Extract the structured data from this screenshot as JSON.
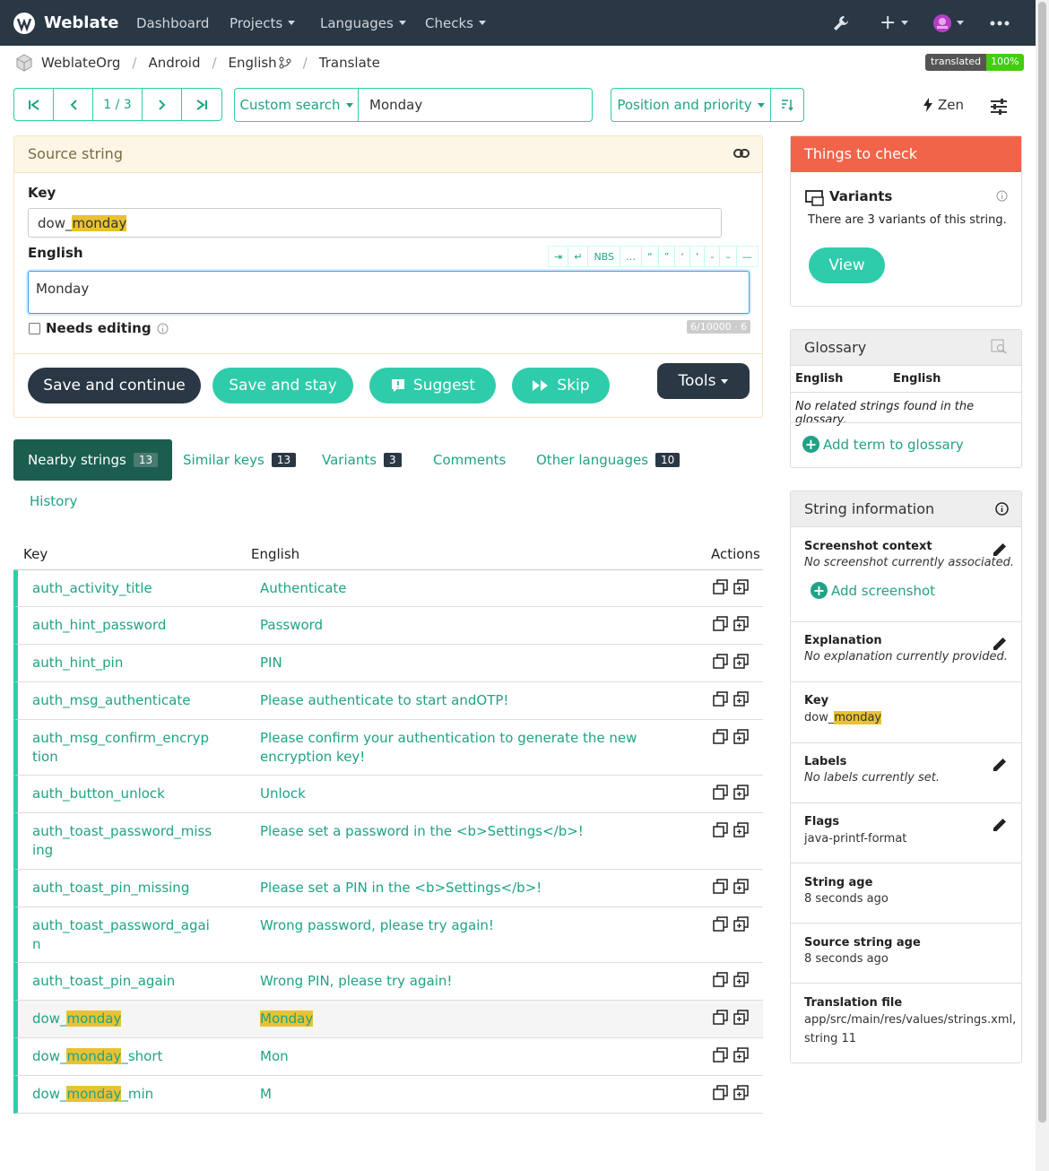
{
  "nav": {
    "brand": "Weblate",
    "items": [
      "Dashboard",
      "Projects",
      "Languages",
      "Checks"
    ]
  },
  "breadcrumb": [
    "WeblateOrg",
    "Android",
    "English",
    "Translate"
  ],
  "badge": {
    "label": "translated",
    "value": "100%"
  },
  "toolbar": {
    "position": "1 / 3",
    "search_button": "Custom search",
    "search_value": "Monday",
    "sort_button": "Position and priority",
    "zen": "Zen"
  },
  "source": {
    "title": "Source string",
    "key_label": "Key",
    "key_prefix": "dow_",
    "key_highlight": "monday",
    "lang_label": "English",
    "special_chars": [
      "⇥",
      "↵",
      "NBS",
      "…",
      "“",
      "”",
      "‘",
      "’",
      "-",
      "–",
      "—"
    ],
    "text": "Monday",
    "needs_editing": "Needs editing",
    "counter": "6/10000 · 6",
    "buttons": {
      "save_continue": "Save and continue",
      "save_stay": "Save and stay",
      "suggest": "Suggest",
      "skip": "Skip",
      "tools": "Tools"
    }
  },
  "tabs": [
    {
      "label": "Nearby strings",
      "count": "13"
    },
    {
      "label": "Similar keys",
      "count": "13"
    },
    {
      "label": "Variants",
      "count": "3"
    },
    {
      "label": "Comments",
      "count": ""
    },
    {
      "label": "Other languages",
      "count": "10"
    },
    {
      "label": "History",
      "count": ""
    }
  ],
  "table": {
    "headers": [
      "Key",
      "English",
      "Actions"
    ],
    "rows": [
      {
        "key": "auth_activity_title",
        "text": "Authenticate"
      },
      {
        "key": "auth_hint_password",
        "text": "Password"
      },
      {
        "key": "auth_hint_pin",
        "text": "PIN"
      },
      {
        "key": "auth_msg_authenticate",
        "text": "Please authenticate to start andOTP!"
      },
      {
        "key": "auth_msg_confirm_encryp",
        "key2": "tion",
        "text": "Please confirm your authentication to generate the new",
        "text2": "encryption key!"
      },
      {
        "key": "auth_button_unlock",
        "text": "Unlock"
      },
      {
        "key": "auth_toast_password_miss",
        "key2": "ing",
        "text": "Please set a password in the <b>Settings</b>!"
      },
      {
        "key": "auth_toast_pin_missing",
        "text": "Please set a PIN in the <b>Settings</b>!"
      },
      {
        "key": "auth_toast_password_agai",
        "key2": "n",
        "text": "Wrong password, please try again!"
      },
      {
        "key": "auth_toast_pin_again",
        "text": "Wrong PIN, please try again!"
      },
      {
        "key_pre": "dow_",
        "key_hl": "monday",
        "key_post": "",
        "text_hl": "Monday"
      },
      {
        "key_pre": "dow_",
        "key_hl": "monday",
        "key_post": "_short",
        "text": "Mon"
      },
      {
        "key_pre": "dow_",
        "key_hl": "monday",
        "key_post": "_min",
        "text": "M"
      }
    ]
  },
  "checks": {
    "title": "Things to check",
    "variants_title": "Variants",
    "variants_text": "There are 3 variants of this string.",
    "view": "View"
  },
  "glossary": {
    "title": "Glossary",
    "col1": "English",
    "col2": "English",
    "empty": "No related strings found in the glossary.",
    "add": "Add term to glossary"
  },
  "info": {
    "title": "String information",
    "screenshot_title": "Screenshot context",
    "screenshot_val": "No screenshot currently associated.",
    "add_screenshot": "Add screenshot",
    "explanation_title": "Explanation",
    "explanation_val": "No explanation currently provided.",
    "key_title": "Key",
    "key_prefix": "dow_",
    "key_hl": "monday",
    "labels_title": "Labels",
    "labels_val": "No labels currently set.",
    "flags_title": "Flags",
    "flags_val": "java-printf-format",
    "age_title": "String age",
    "age_val": "8 seconds ago",
    "src_age_title": "Source string age",
    "src_age_val": "8 seconds ago",
    "file_title": "Translation file",
    "file_val1": "app/src/main/res/values/strings.xml,",
    "file_val2": "string 11"
  },
  "colors": {
    "navbar": "#2a3744",
    "accent": "#2eccaa",
    "check": "#f2644a",
    "highlight": "#e9c232"
  }
}
